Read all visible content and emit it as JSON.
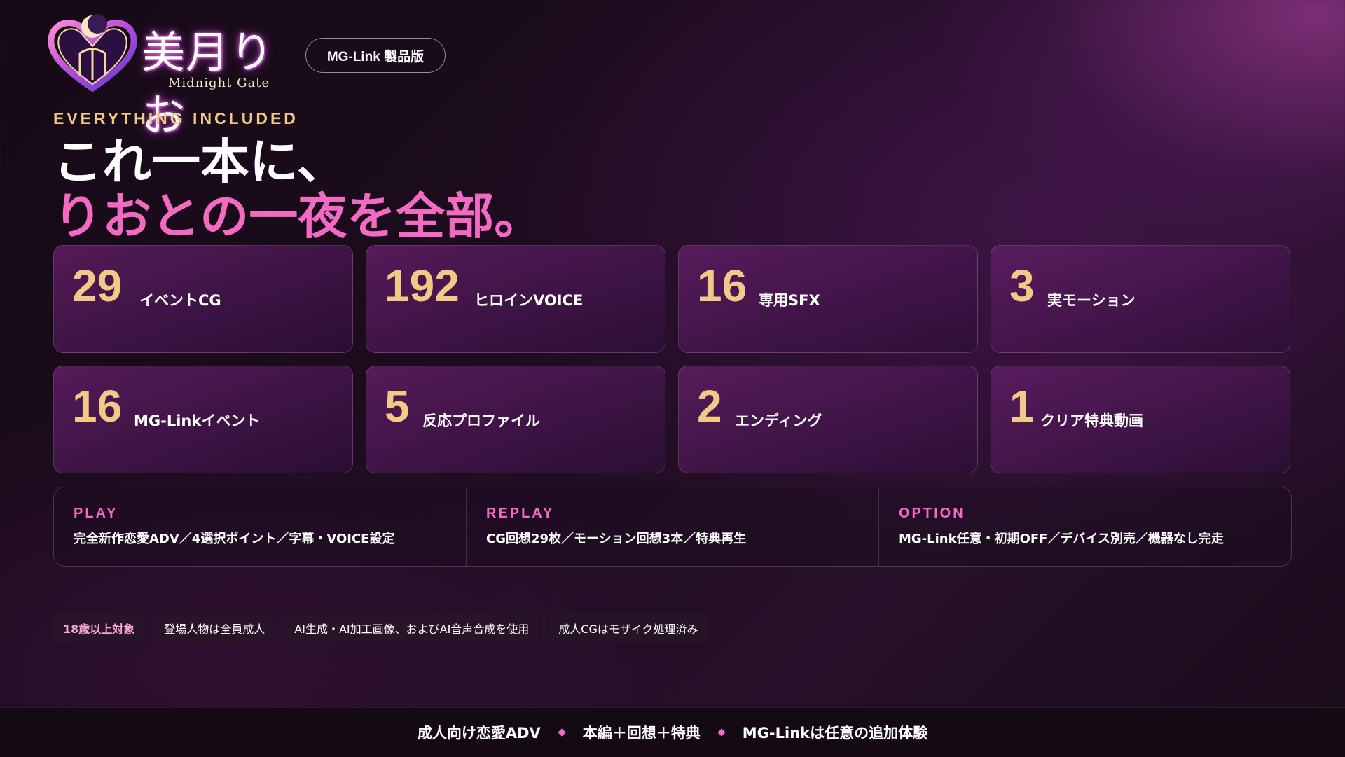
{
  "brand": {
    "title": "美月りお",
    "subtitle": "Midnight Gate",
    "edition_badge": "MG-Link 製品版"
  },
  "hero": {
    "eyebrow": "EVERYTHING INCLUDED",
    "headline_line1": "これ一本に、",
    "headline_line2": "りおとの一夜を全部。"
  },
  "stats": [
    {
      "value": "29",
      "label": "イベントCG"
    },
    {
      "value": "192",
      "label": "ヒロインVOICE"
    },
    {
      "value": "16",
      "label": "専用SFX"
    },
    {
      "value": "3",
      "label": "実モーション"
    },
    {
      "value": "16",
      "label": "MG-Linkイベント"
    },
    {
      "value": "5",
      "label": "反応プロファイル"
    },
    {
      "value": "2",
      "label": "エンディング"
    },
    {
      "value": "1",
      "label": "クリア特典動画"
    }
  ],
  "features": [
    {
      "heading": "PLAY",
      "body": "完全新作恋愛ADV／4選択ポイント／字幕・VOICE設定"
    },
    {
      "heading": "REPLAY",
      "body": "CG回想29枚／モーション回想3本／特典再生"
    },
    {
      "heading": "OPTION",
      "body": "MG-Link任意・初期OFF／デバイス別売／機器なし完走"
    }
  ],
  "notices": [
    "18歳以上対象",
    "登場人物は全員成人",
    "AI生成・AI加工画像、およびAI音声合成を使用",
    "成人CGはモザイク処理済み"
  ],
  "footer": {
    "items": [
      "成人向け恋愛ADV",
      "本編＋回想＋特典",
      "MG-Linkは任意の追加体験"
    ]
  },
  "colors": {
    "accent_pink": "#f26ac2",
    "accent_gold": "#f2c987",
    "background": "#1d0c1f"
  },
  "icons": {
    "logo_emblem": "heart-moon-emblem-icon",
    "separator": "diamond-icon"
  }
}
